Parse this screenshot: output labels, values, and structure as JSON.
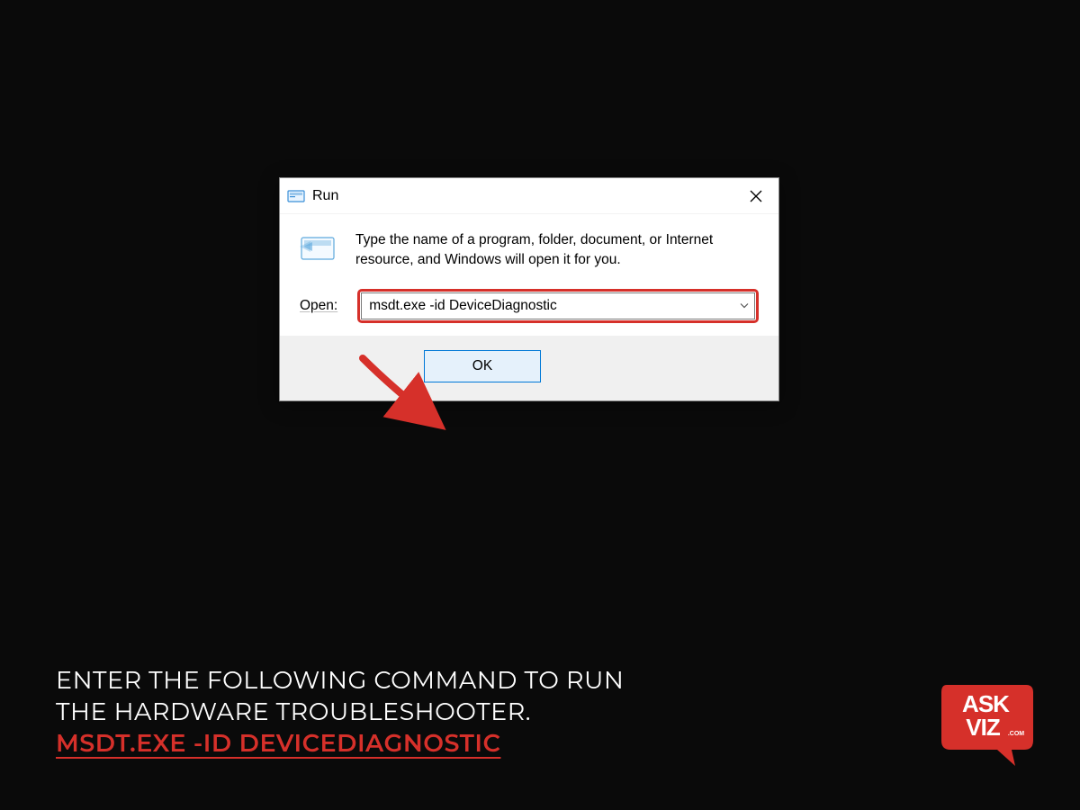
{
  "dialog": {
    "title": "Run",
    "description": "Type the name of a program, folder, document, or Internet resource, and Windows will open it for you.",
    "open_label": "Open:",
    "open_value": "msdt.exe -id DeviceDiagnostic",
    "ok_label": "OK"
  },
  "caption": {
    "line1": "ENTER THE FOLLOWING COMMAND TO RUN",
    "line2": "THE HARDWARE TROUBLESHOOTER.",
    "command": "MSDT.EXE -ID DEVICEDIAGNOSTIC"
  },
  "logo": {
    "text_top": "ASK",
    "text_bottom": "VIZ",
    "suffix": ".COM"
  },
  "colors": {
    "highlight": "#d6302a",
    "button_border": "#0078d7",
    "button_bg": "#e5f1fb"
  }
}
